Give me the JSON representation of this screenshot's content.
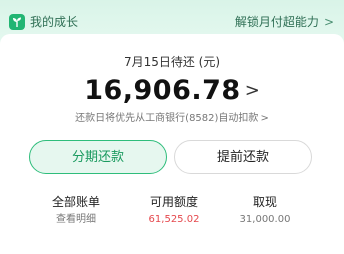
{
  "header": {
    "growth_label": "我的成长",
    "unlock_label": "解锁月付超能力",
    "icon": "sprout-icon"
  },
  "bill": {
    "due_label": "7月15日待还 (元)",
    "amount": "16,906.78",
    "autopay_note": "还款日将优先从工商银行(8582)自动扣款"
  },
  "buttons": {
    "installment": "分期还款",
    "prepay": "提前还款"
  },
  "stats": {
    "bills_title": "全部账单",
    "bills_sub": "查看明细",
    "credit_title": "可用额度",
    "credit_value": "61,525.02",
    "cash_title": "取现",
    "cash_value": "31,000.00"
  },
  "colors": {
    "accent": "#2ebd7b",
    "header_bg": "#e6f7ef",
    "credit_value": "#e5484d"
  }
}
